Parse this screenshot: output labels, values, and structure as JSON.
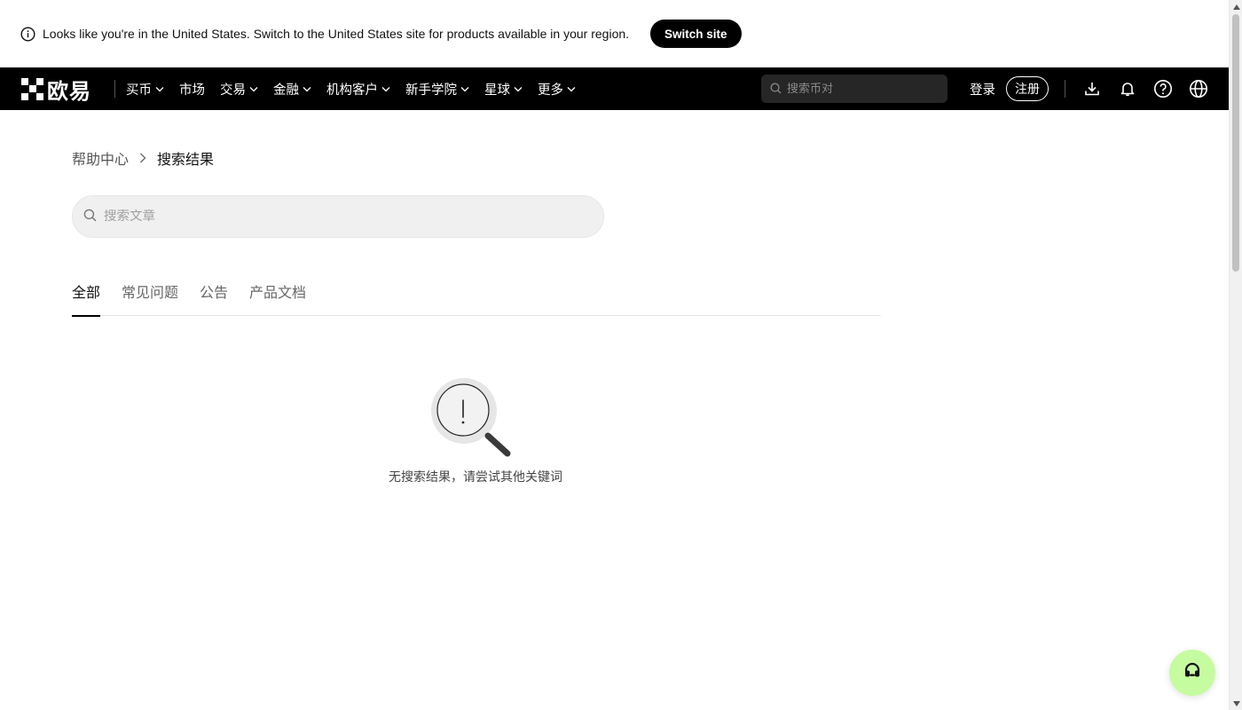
{
  "banner": {
    "message": "Looks like you're in the United States. Switch to the United States site for products available in your region.",
    "switch_label": "Switch site",
    "icon": "info-icon"
  },
  "nav": {
    "logo_text": "欧易",
    "items": [
      {
        "label": "买币",
        "dropdown": true
      },
      {
        "label": "市场",
        "dropdown": false
      },
      {
        "label": "交易",
        "dropdown": true
      },
      {
        "label": "金融",
        "dropdown": true
      },
      {
        "label": "机构客户",
        "dropdown": true
      },
      {
        "label": "新手学院",
        "dropdown": true
      },
      {
        "label": "星球",
        "dropdown": true
      },
      {
        "label": "更多",
        "dropdown": true
      }
    ],
    "search_placeholder": "搜索币对",
    "login_label": "登录",
    "register_label": "注册",
    "icons": [
      "download-icon",
      "bell-icon",
      "help-icon",
      "globe-icon"
    ]
  },
  "breadcrumb": {
    "home": "帮助中心",
    "current": "搜索结果"
  },
  "article_search": {
    "placeholder": "搜索文章",
    "value": ""
  },
  "tabs": [
    {
      "label": "全部",
      "active": true
    },
    {
      "label": "常见问题",
      "active": false
    },
    {
      "label": "公告",
      "active": false
    },
    {
      "label": "产品文档",
      "active": false
    }
  ],
  "empty_state": {
    "message": "无搜索结果，请尝试其他关键词",
    "icon": "magnifier-exclamation-icon"
  },
  "support": {
    "icon": "headset-icon",
    "color": "#c6fca0"
  }
}
